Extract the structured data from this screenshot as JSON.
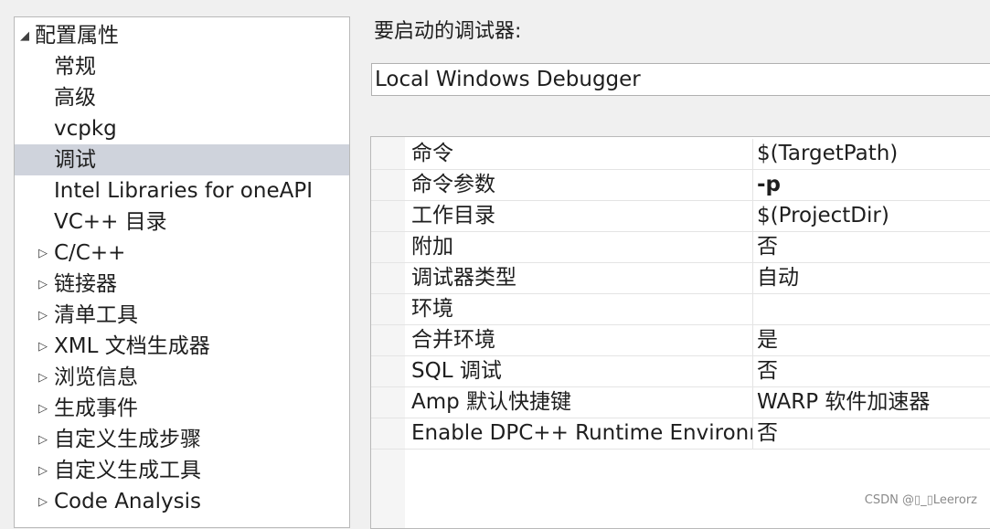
{
  "tree": {
    "items": [
      {
        "label": "配置属性",
        "arrow": "◢",
        "expanded": true,
        "level": 0
      },
      {
        "label": "常规",
        "arrow": "",
        "level": 1
      },
      {
        "label": "高级",
        "arrow": "",
        "level": 1
      },
      {
        "label": "vcpkg",
        "arrow": "",
        "level": 1
      },
      {
        "label": "调试",
        "arrow": "",
        "level": 1,
        "selected": true
      },
      {
        "label": "Intel Libraries for oneAPI",
        "arrow": "",
        "level": 1
      },
      {
        "label": "VC++ 目录",
        "arrow": "",
        "level": 1
      },
      {
        "label": "C/C++",
        "arrow": "▷",
        "level": 1
      },
      {
        "label": "链接器",
        "arrow": "▷",
        "level": 1
      },
      {
        "label": "清单工具",
        "arrow": "▷",
        "level": 1
      },
      {
        "label": "XML 文档生成器",
        "arrow": "▷",
        "level": 1
      },
      {
        "label": "浏览信息",
        "arrow": "▷",
        "level": 1
      },
      {
        "label": "生成事件",
        "arrow": "▷",
        "level": 1
      },
      {
        "label": "自定义生成步骤",
        "arrow": "▷",
        "level": 1
      },
      {
        "label": "自定义生成工具",
        "arrow": "▷",
        "level": 1
      },
      {
        "label": "Code Analysis",
        "arrow": "▷",
        "level": 1
      }
    ]
  },
  "debugger": {
    "label": "要启动的调试器:",
    "selected": "Local Windows Debugger"
  },
  "properties": {
    "rows": [
      {
        "name": "命令",
        "value": "$(TargetPath)"
      },
      {
        "name": "命令参数",
        "value": "-p",
        "bold": true
      },
      {
        "name": "工作目录",
        "value": "$(ProjectDir)"
      },
      {
        "name": "附加",
        "value": "否"
      },
      {
        "name": "调试器类型",
        "value": "自动"
      },
      {
        "name": "环境",
        "value": ""
      },
      {
        "name": "合并环境",
        "value": "是"
      },
      {
        "name": "SQL 调试",
        "value": "否"
      },
      {
        "name": "Amp 默认快捷键",
        "value": "WARP 软件加速器"
      },
      {
        "name": "Enable DPC++ Runtime Environment",
        "value": "否"
      }
    ]
  },
  "watermark": "CSDN @▯_▯Leerorz",
  "colors": {
    "selected_row": "#cfd3dc",
    "panel_bg": "#ffffff",
    "window_bg": "#f0f0f0"
  }
}
